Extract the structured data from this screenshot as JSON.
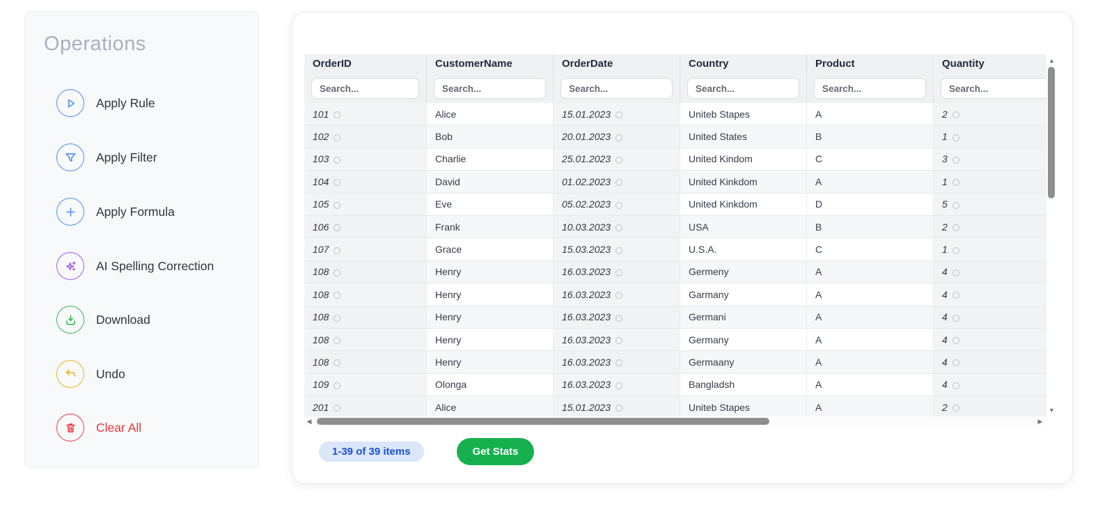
{
  "sidebar": {
    "title": "Operations",
    "items": [
      {
        "label": "Apply Rule",
        "icon": "play-icon",
        "color": "#4a90f4"
      },
      {
        "label": "Apply Filter",
        "icon": "funnel-icon",
        "color": "#4a90f4"
      },
      {
        "label": "Apply Formula",
        "icon": "plus-icon",
        "color": "#4a90f4"
      },
      {
        "label": "AI Spelling Correction",
        "icon": "sparkles-icon",
        "color": "#a557f0"
      },
      {
        "label": "Download",
        "icon": "download-icon",
        "color": "#2dbd4e"
      },
      {
        "label": "Undo",
        "icon": "undo-icon",
        "color": "#edb21a"
      },
      {
        "label": "Clear All",
        "icon": "trash-icon",
        "color": "#ed3b46"
      }
    ]
  },
  "table": {
    "search_placeholder": "Search...",
    "columns": [
      {
        "key": "OrderID",
        "label": "OrderID",
        "type": "numeric"
      },
      {
        "key": "CustomerName",
        "label": "CustomerName",
        "type": "text"
      },
      {
        "key": "OrderDate",
        "label": "OrderDate",
        "type": "numeric"
      },
      {
        "key": "Country",
        "label": "Country",
        "type": "text"
      },
      {
        "key": "Product",
        "label": "Product",
        "type": "text"
      },
      {
        "key": "Quantity",
        "label": "Quantity",
        "type": "numeric"
      }
    ],
    "rows": [
      {
        "OrderID": "101",
        "CustomerName": "Alice",
        "OrderDate": "15.01.2023",
        "Country": "Uniteb Stapes",
        "Product": "A",
        "Quantity": "2"
      },
      {
        "OrderID": "102",
        "CustomerName": "Bob",
        "OrderDate": "20.01.2023",
        "Country": "United States",
        "Product": "B",
        "Quantity": "1"
      },
      {
        "OrderID": "103",
        "CustomerName": "Charlie",
        "OrderDate": "25.01.2023",
        "Country": "United Kindom",
        "Product": "C",
        "Quantity": "3"
      },
      {
        "OrderID": "104",
        "CustomerName": "David",
        "OrderDate": "01.02.2023",
        "Country": "United Kinkdom",
        "Product": "A",
        "Quantity": "1"
      },
      {
        "OrderID": "105",
        "CustomerName": "Eve",
        "OrderDate": "05.02.2023",
        "Country": "United Kinkdom",
        "Product": "D",
        "Quantity": "5"
      },
      {
        "OrderID": "106",
        "CustomerName": "Frank",
        "OrderDate": "10.03.2023",
        "Country": "USA",
        "Product": "B",
        "Quantity": "2"
      },
      {
        "OrderID": "107",
        "CustomerName": "Grace",
        "OrderDate": "15.03.2023",
        "Country": "U.S.A.",
        "Product": "C",
        "Quantity": "1"
      },
      {
        "OrderID": "108",
        "CustomerName": "Henry",
        "OrderDate": "16.03.2023",
        "Country": "Germeny",
        "Product": "A",
        "Quantity": "4"
      },
      {
        "OrderID": "108",
        "CustomerName": "Henry",
        "OrderDate": "16.03.2023",
        "Country": "Garmany",
        "Product": "A",
        "Quantity": "4"
      },
      {
        "OrderID": "108",
        "CustomerName": "Henry",
        "OrderDate": "16.03.2023",
        "Country": "Germani",
        "Product": "A",
        "Quantity": "4"
      },
      {
        "OrderID": "108",
        "CustomerName": "Henry",
        "OrderDate": "16.03.2023",
        "Country": "Germany",
        "Product": "A",
        "Quantity": "4"
      },
      {
        "OrderID": "108",
        "CustomerName": "Henry",
        "OrderDate": "16.03.2023",
        "Country": "Germaany",
        "Product": "A",
        "Quantity": "4"
      },
      {
        "OrderID": "109",
        "CustomerName": "Olonga",
        "OrderDate": "16.03.2023",
        "Country": "Bangladsh",
        "Product": "A",
        "Quantity": "4"
      },
      {
        "OrderID": "201",
        "CustomerName": "Alice",
        "OrderDate": "15.01.2023",
        "Country": "Uniteb Stapes",
        "Product": "A",
        "Quantity": "2"
      }
    ]
  },
  "footer": {
    "items_count": "1-39 of 39 items",
    "get_stats_label": "Get Stats"
  },
  "scrollbar": {
    "up_arrow": "▲",
    "down_arrow": "▼",
    "left_arrow": "◀",
    "right_arrow": "▶"
  },
  "colors": {
    "badge_bg": "#dbe6f9",
    "badge_text": "#1d4fd7",
    "stats_button": "#16b14e",
    "clear_all_text": "#e5393f",
    "header_bg": "#eff1f3",
    "stripe_row": "#f6f7f8"
  }
}
